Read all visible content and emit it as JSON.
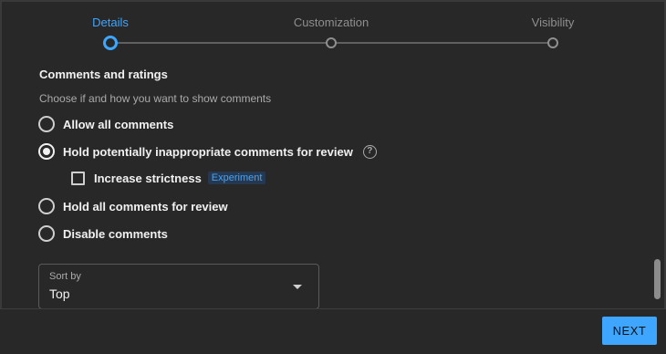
{
  "stepper": {
    "steps": [
      {
        "label": "Details",
        "state": "active"
      },
      {
        "label": "Customization",
        "state": "inactive"
      },
      {
        "label": "Visibility",
        "state": "inactive"
      }
    ]
  },
  "comments": {
    "title": "Comments and ratings",
    "subtitle": "Choose if and how you want to show comments",
    "options": [
      {
        "label": "Allow all comments",
        "checked": false
      },
      {
        "label": "Hold potentially inappropriate comments for review",
        "checked": true
      },
      {
        "label": "Hold all comments for review",
        "checked": false
      },
      {
        "label": "Disable comments",
        "checked": false
      }
    ],
    "strictness": {
      "label": "Increase strictness",
      "badge": "Experiment",
      "checked": false
    }
  },
  "sort": {
    "caption": "Sort by",
    "value": "Top"
  },
  "footer": {
    "next_label": "NEXT"
  },
  "colors": {
    "accent": "#3ea6ff",
    "background": "#282828"
  },
  "icons": [
    "help-icon",
    "chevron-down-icon"
  ]
}
